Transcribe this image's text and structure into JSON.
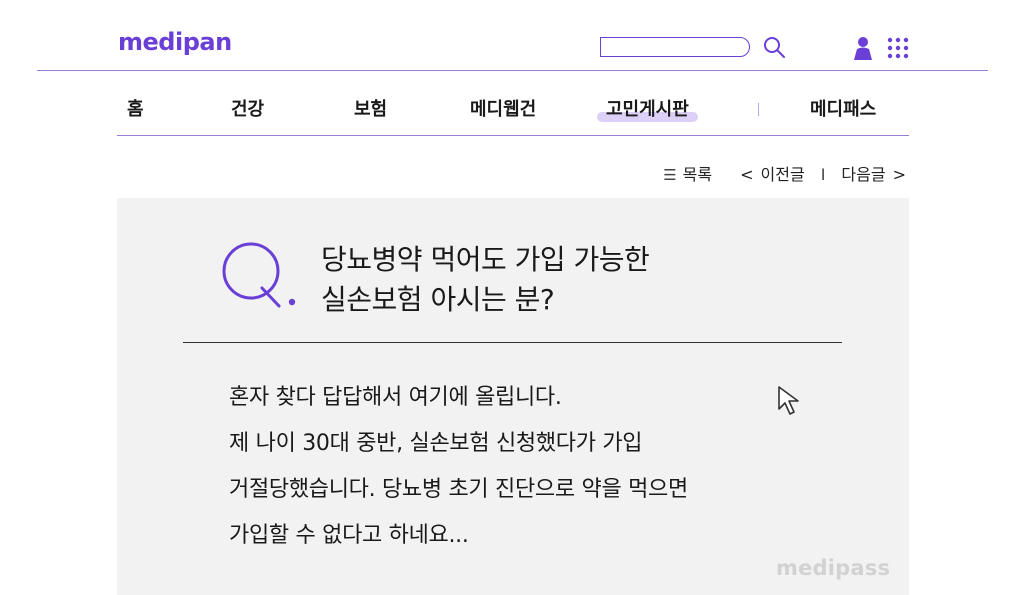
{
  "header": {
    "logo": "medipan",
    "search": {
      "value": "",
      "placeholder": ""
    },
    "icons": {
      "search": "search-icon",
      "user": "user-icon",
      "apps": "apps-grid-icon"
    },
    "accent_color": "#6a3fd6"
  },
  "nav": {
    "items": [
      {
        "label": "홈"
      },
      {
        "label": "건강"
      },
      {
        "label": "보험"
      },
      {
        "label": "메디웹건"
      },
      {
        "label": "고민게시판",
        "active": true
      },
      {
        "label": "메디패스"
      }
    ]
  },
  "post_nav": {
    "list_label": "목록",
    "prev_label": "이전글",
    "next_label": "다음글",
    "separator": "I"
  },
  "question": {
    "title_line1": "당뇨병약 먹어도 가입 가능한",
    "title_line2": "실손보험 아시는 분?"
  },
  "body": {
    "lines": [
      "혼자 찾다 답답해서 여기에 올립니다.",
      "제 나이 30대 중반, 실손보험 신청했다가 가입",
      "거절당했습니다. 당뇨병 초기 진단으로 약을 먹으면",
      "가입할 수 없다고 하네요..."
    ]
  },
  "watermark": "medipass"
}
